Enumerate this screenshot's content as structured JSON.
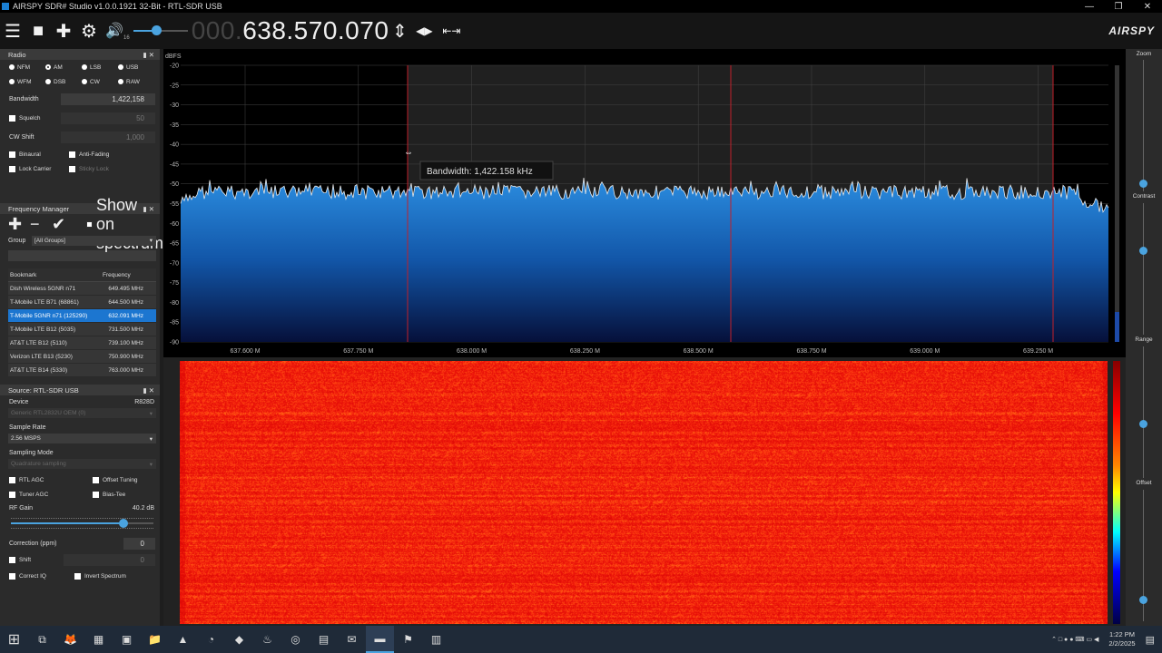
{
  "window": {
    "title": "AIRSPY SDR# Studio v1.0.0.1921 32-Bit - RTL-SDR USB",
    "minimize": "—",
    "maximize": "❐",
    "close": "✕"
  },
  "toolbar": {
    "menu_icon": "☰",
    "stop_icon": "■",
    "add_icon": "✚",
    "settings_icon": "⚙",
    "volume_icon": "🔊",
    "volume_level": "16",
    "freq_dim": "000.",
    "freq_lit": "638.570.070",
    "tune_icon": "⇕",
    "step_icon": "◀▶",
    "span_icon": "⇤⇥",
    "brand": "AIRSPY"
  },
  "radio": {
    "title": "Radio",
    "modes": [
      "NFM",
      "AM",
      "LSB",
      "USB",
      "WFM",
      "DSB",
      "CW",
      "RAW"
    ],
    "selected_mode": "AM",
    "bandwidth_label": "Bandwidth",
    "bandwidth_value": "1,422,158",
    "squelch_label": "Squelch",
    "squelch_value": "50",
    "cwshift_label": "CW Shift",
    "cwshift_value": "1,000",
    "binaural": "Binaural",
    "antifading": "Anti-Fading",
    "lockcarrier": "Lock Carrier",
    "stickylock": "Sticky Lock"
  },
  "freqmgr": {
    "title": "Frequency Manager",
    "show_on_spectrum": "Show on spectrum",
    "group_label": "Group",
    "group_value": "[All Groups]",
    "col_bookmark": "Bookmark",
    "col_frequency": "Frequency",
    "rows": [
      {
        "name": "Dish Wireless 5GNR n71",
        "freq": "649.495 MHz"
      },
      {
        "name": "T-Mobile LTE B71 (68861)",
        "freq": "644.500 MHz"
      },
      {
        "name": "T-Mobile 5GNR n71 (125290)",
        "freq": "632.091 MHz"
      },
      {
        "name": "T-Mobile LTE B12 (5035)",
        "freq": "731.500 MHz"
      },
      {
        "name": "AT&T LTE B12 (5110)",
        "freq": "739.100 MHz"
      },
      {
        "name": "Verizon LTE B13 (5230)",
        "freq": "750.900 MHz"
      },
      {
        "name": "AT&T LTE B14 (5330)",
        "freq": "763.000 MHz"
      }
    ],
    "selected_row": 2
  },
  "source": {
    "title": "Source: RTL-SDR USB",
    "device_label": "Device",
    "device_value": "R828D",
    "device_select": "Generic RTL2832U OEM (0)",
    "samplerate_label": "Sample Rate",
    "samplerate_value": "2.56 MSPS",
    "samplingmode_label": "Sampling Mode",
    "samplingmode_value": "Quadrature sampling",
    "rtlagc": "RTL AGC",
    "offsettuning": "Offset Tuning",
    "tuneragc": "Tuner AGC",
    "biastee": "Bias-Tee",
    "rfgain_label": "RF Gain",
    "rfgain_value": "40.2 dB",
    "rfgain_level": 0.79,
    "correction_label": "Correction (ppm)",
    "correction_value": "0",
    "shift_label": "Shift",
    "shift_value": "0",
    "correctiq": "Correct IQ",
    "invertspectrum": "Invert Spectrum"
  },
  "spectrum": {
    "unit": "dBFS",
    "y_ticks": [
      "-20",
      "-25",
      "-30",
      "-35",
      "-40",
      "-45",
      "-50",
      "-55",
      "-60",
      "-65",
      "-70",
      "-75",
      "-80",
      "-85",
      "-90"
    ],
    "x_ticks": [
      "637.600 M",
      "637.750 M",
      "638.000 M",
      "638.250 M",
      "638.500 M",
      "638.750 M",
      "639.000 M",
      "639.250 M"
    ],
    "tooltip": "Bandwidth: 1,422.158 kHz",
    "accent": "#1a78d0"
  },
  "right": {
    "zoom": "Zoom",
    "contrast": "Contrast",
    "range": "Range",
    "offset": "Offset"
  },
  "taskbar": {
    "start_icon": "⊞",
    "task_view_icon": "⧉",
    "apps": [
      "🦊",
      "▦",
      "▣",
      "📁",
      "▲",
      "◔",
      "◆",
      "♨",
      "◎",
      "▤",
      "✉",
      "▬",
      "⚑",
      "▥"
    ],
    "tray": "⌃  □  ●  ●  ⌨  ▭  ◀",
    "time": "1:22 PM",
    "date": "2/2/2025",
    "notify_icon": "▤"
  }
}
